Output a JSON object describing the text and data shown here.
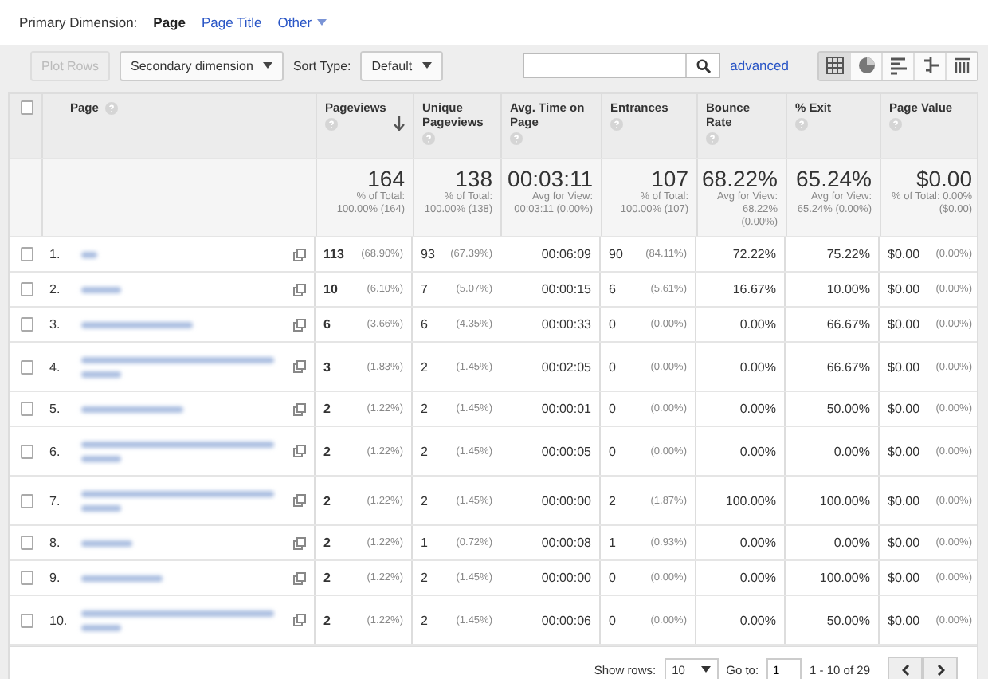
{
  "primary_dimension": {
    "label": "Primary Dimension:",
    "options": [
      {
        "label": "Page",
        "selected": true,
        "kind": "link"
      },
      {
        "label": "Page Title",
        "selected": false,
        "kind": "link"
      },
      {
        "label": "Other",
        "selected": false,
        "kind": "dropdown"
      }
    ]
  },
  "toolbar": {
    "plot_rows": {
      "label": "Plot Rows",
      "disabled": true
    },
    "secondary_dimension": "Secondary dimension",
    "sort_type_label": "Sort Type:",
    "sort_type": "Default",
    "advanced": "advanced",
    "views": [
      {
        "kind": "table",
        "selected": true
      },
      {
        "kind": "pie",
        "selected": false
      },
      {
        "kind": "bar",
        "selected": false
      },
      {
        "kind": "compare",
        "selected": false
      },
      {
        "kind": "pivot",
        "selected": false
      }
    ]
  },
  "table": {
    "select_all_checked": false,
    "columns": [
      {
        "label": "Page",
        "help": true,
        "sorted": false
      },
      {
        "label": "Pageviews",
        "help": true,
        "sorted": true
      },
      {
        "label": "Unique Pageviews",
        "help": true,
        "sorted": false
      },
      {
        "label": "Avg. Time on Page",
        "help": true,
        "sorted": false
      },
      {
        "label": "Entrances",
        "help": true,
        "sorted": false
      },
      {
        "label": "Bounce Rate",
        "help": true,
        "sorted": false
      },
      {
        "label": "% Exit",
        "help": true,
        "sorted": false
      },
      {
        "label": "Page Value",
        "help": true,
        "sorted": false
      }
    ],
    "totals": [
      {
        "value": "164",
        "note": "% of Total: 100.00% (164)"
      },
      {
        "value": "138",
        "note": "% of Total: 100.00% (138)"
      },
      {
        "value": "00:03:11",
        "note": "Avg for View: 00:03:11 (0.00%)"
      },
      {
        "value": "107",
        "note": "% of Total: 100.00% (107)"
      },
      {
        "value": "68.22%",
        "note": "Avg for View: 68.22% (0.00%)"
      },
      {
        "value": "65.24%",
        "note": "Avg for View: 65.24% (0.00%)"
      },
      {
        "value": "$0.00",
        "note": "% of Total: 0.00% ($0.00)"
      }
    ],
    "rows": [
      {
        "index": "1.",
        "checked": false,
        "wrapped": false,
        "pageviews": "113",
        "pageviews_pct": "(68.90%)",
        "unique": "93",
        "unique_pct": "(67.39%)",
        "avg_time": "00:06:09",
        "entrances": "90",
        "entrances_pct": "(84.11%)",
        "bounce": "72.22%",
        "exit": "75.22%",
        "value": "$0.00",
        "value_pct": "(0.00%)"
      },
      {
        "index": "2.",
        "checked": false,
        "wrapped": false,
        "pageviews": "10",
        "pageviews_pct": "(6.10%)",
        "unique": "7",
        "unique_pct": "(5.07%)",
        "avg_time": "00:00:15",
        "entrances": "6",
        "entrances_pct": "(5.61%)",
        "bounce": "16.67%",
        "exit": "10.00%",
        "value": "$0.00",
        "value_pct": "(0.00%)"
      },
      {
        "index": "3.",
        "checked": false,
        "wrapped": false,
        "pageviews": "6",
        "pageviews_pct": "(3.66%)",
        "unique": "6",
        "unique_pct": "(4.35%)",
        "avg_time": "00:00:33",
        "entrances": "0",
        "entrances_pct": "(0.00%)",
        "bounce": "0.00%",
        "exit": "66.67%",
        "value": "$0.00",
        "value_pct": "(0.00%)"
      },
      {
        "index": "4.",
        "checked": false,
        "wrapped": true,
        "pageviews": "3",
        "pageviews_pct": "(1.83%)",
        "unique": "2",
        "unique_pct": "(1.45%)",
        "avg_time": "00:02:05",
        "entrances": "0",
        "entrances_pct": "(0.00%)",
        "bounce": "0.00%",
        "exit": "66.67%",
        "value": "$0.00",
        "value_pct": "(0.00%)"
      },
      {
        "index": "5.",
        "checked": false,
        "wrapped": false,
        "pageviews": "2",
        "pageviews_pct": "(1.22%)",
        "unique": "2",
        "unique_pct": "(1.45%)",
        "avg_time": "00:00:01",
        "entrances": "0",
        "entrances_pct": "(0.00%)",
        "bounce": "0.00%",
        "exit": "50.00%",
        "value": "$0.00",
        "value_pct": "(0.00%)"
      },
      {
        "index": "6.",
        "checked": false,
        "wrapped": true,
        "pageviews": "2",
        "pageviews_pct": "(1.22%)",
        "unique": "2",
        "unique_pct": "(1.45%)",
        "avg_time": "00:00:05",
        "entrances": "0",
        "entrances_pct": "(0.00%)",
        "bounce": "0.00%",
        "exit": "0.00%",
        "value": "$0.00",
        "value_pct": "(0.00%)"
      },
      {
        "index": "7.",
        "checked": false,
        "wrapped": true,
        "pageviews": "2",
        "pageviews_pct": "(1.22%)",
        "unique": "2",
        "unique_pct": "(1.45%)",
        "avg_time": "00:00:00",
        "entrances": "2",
        "entrances_pct": "(1.87%)",
        "bounce": "100.00%",
        "exit": "100.00%",
        "value": "$0.00",
        "value_pct": "(0.00%)"
      },
      {
        "index": "8.",
        "checked": false,
        "wrapped": false,
        "pageviews": "2",
        "pageviews_pct": "(1.22%)",
        "unique": "1",
        "unique_pct": "(0.72%)",
        "avg_time": "00:00:08",
        "entrances": "1",
        "entrances_pct": "(0.93%)",
        "bounce": "0.00%",
        "exit": "0.00%",
        "value": "$0.00",
        "value_pct": "(0.00%)"
      },
      {
        "index": "9.",
        "checked": false,
        "wrapped": false,
        "pageviews": "2",
        "pageviews_pct": "(1.22%)",
        "unique": "2",
        "unique_pct": "(1.45%)",
        "avg_time": "00:00:00",
        "entrances": "0",
        "entrances_pct": "(0.00%)",
        "bounce": "0.00%",
        "exit": "100.00%",
        "value": "$0.00",
        "value_pct": "(0.00%)"
      },
      {
        "index": "10.",
        "checked": false,
        "wrapped": true,
        "pageviews": "2",
        "pageviews_pct": "(1.22%)",
        "unique": "2",
        "unique_pct": "(1.45%)",
        "avg_time": "00:00:06",
        "entrances": "0",
        "entrances_pct": "(0.00%)",
        "bounce": "0.00%",
        "exit": "50.00%",
        "value": "$0.00",
        "value_pct": "(0.00%)"
      }
    ]
  },
  "footer": {
    "show_rows_label": "Show rows:",
    "show_rows": "10",
    "goto_label": "Go to:",
    "goto": "1",
    "range": "1 - 10 of 29"
  }
}
